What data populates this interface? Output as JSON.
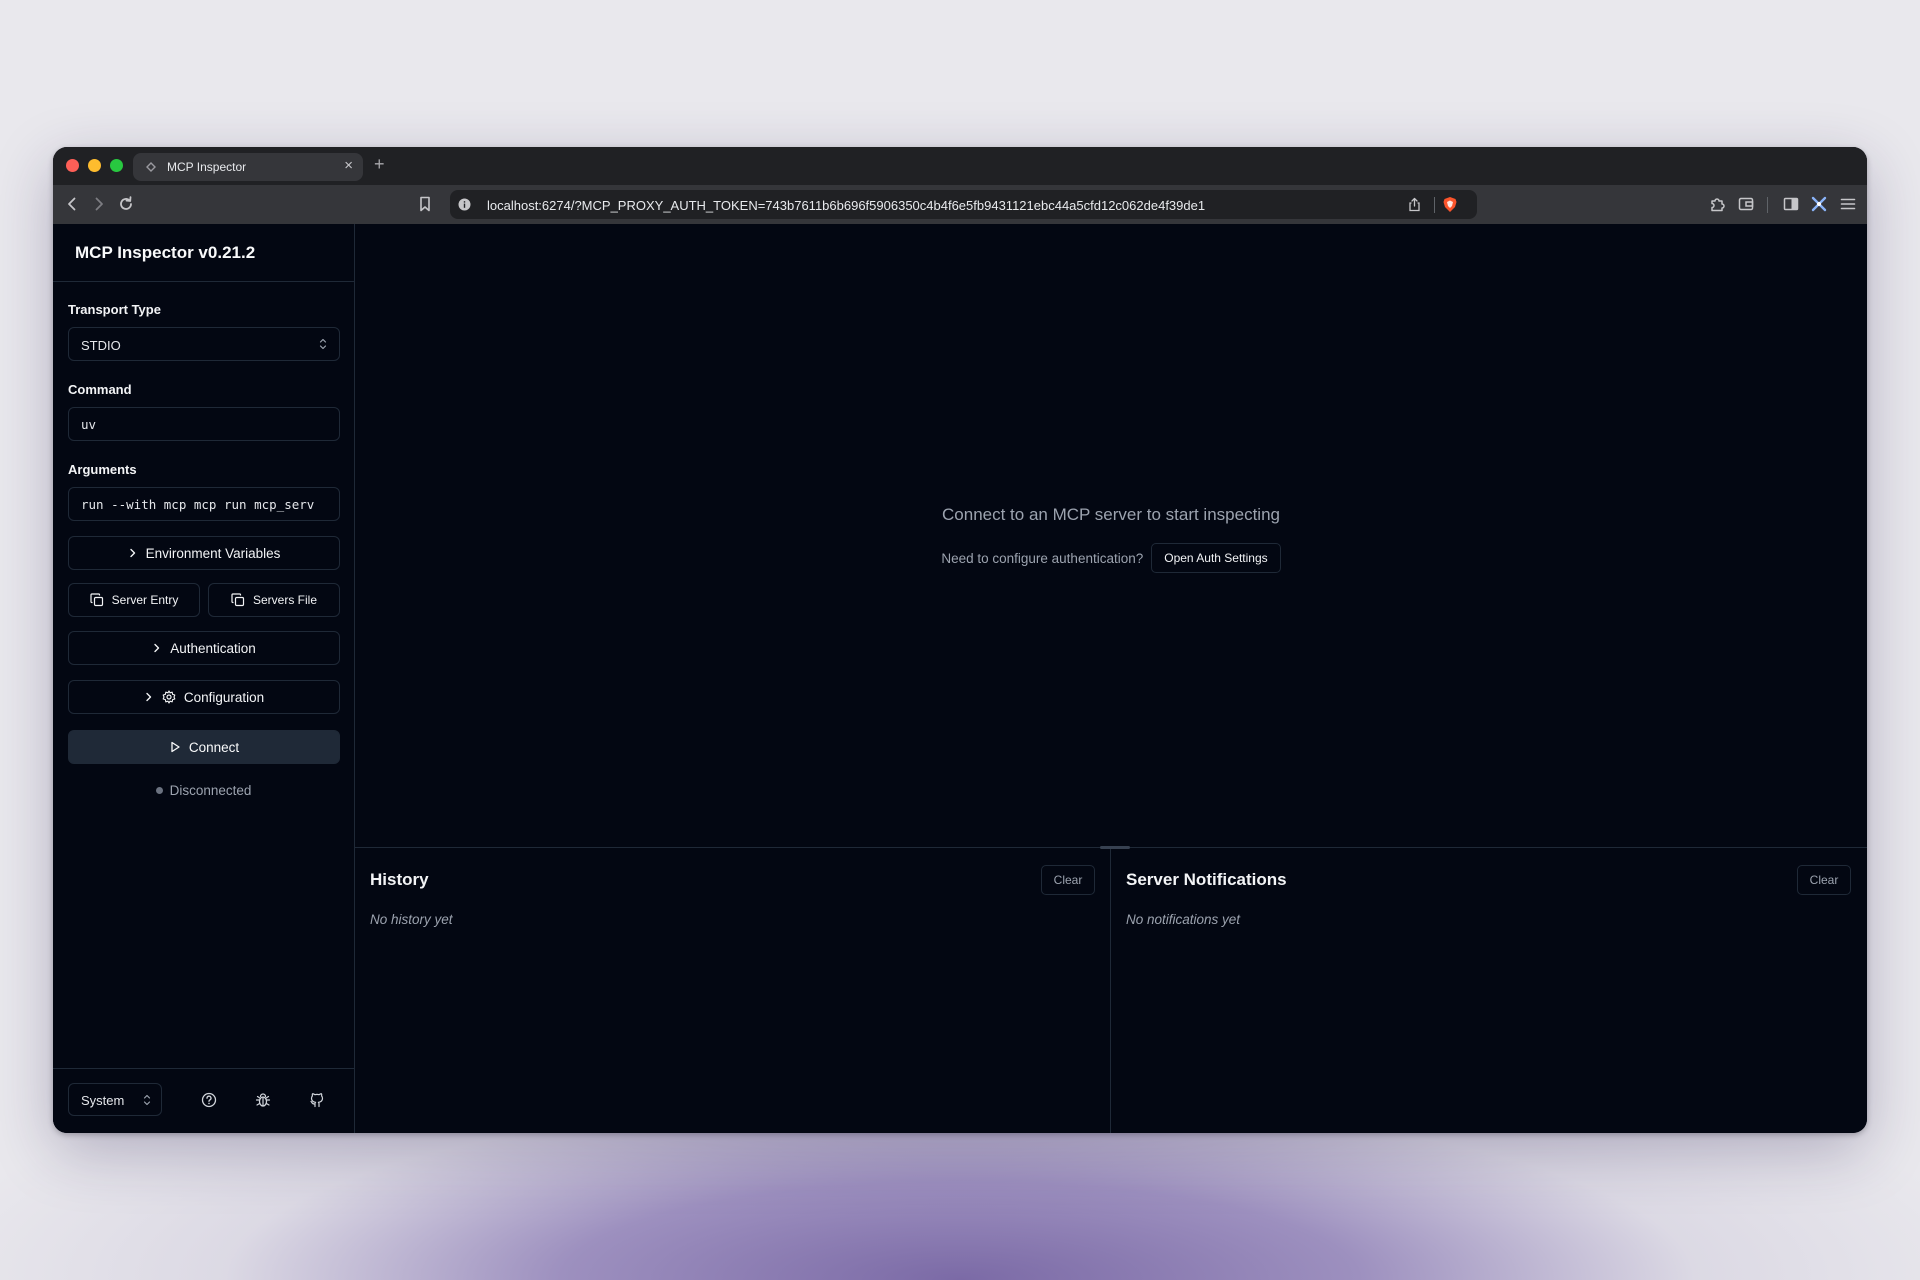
{
  "browser": {
    "tab_title": "MCP Inspector",
    "tab_close": "×",
    "new_tab": "+",
    "url": "localhost:6274/?MCP_PROXY_AUTH_TOKEN=743b7611b6b696f5906350c4b4f6e5fb9431121ebc44a5cfd12c062de4f39de1"
  },
  "sidebar": {
    "title": "MCP Inspector v0.21.2",
    "transport_label": "Transport Type",
    "transport_value": "STDIO",
    "command_label": "Command",
    "command_value": "uv",
    "arguments_label": "Arguments",
    "arguments_value": "run --with mcp mcp run mcp_serv",
    "env_button": "Environment Variables",
    "server_entry_button": "Server Entry",
    "servers_file_button": "Servers File",
    "auth_button": "Authentication",
    "config_button": "Configuration",
    "connect_button": "Connect",
    "status": "Disconnected",
    "theme_value": "System"
  },
  "main": {
    "connect_message": "Connect to an MCP server to start inspecting",
    "auth_prompt": "Need to configure authentication?",
    "auth_button": "Open Auth Settings"
  },
  "history": {
    "title": "History",
    "clear": "Clear",
    "empty": "No history yet"
  },
  "notifications": {
    "title": "Server Notifications",
    "clear": "Clear",
    "empty": "No notifications yet"
  },
  "colors": {
    "app_background": "#030712",
    "border": "#1f2937",
    "muted_text": "#9ca3af",
    "brave_accent": "#fb542b"
  }
}
